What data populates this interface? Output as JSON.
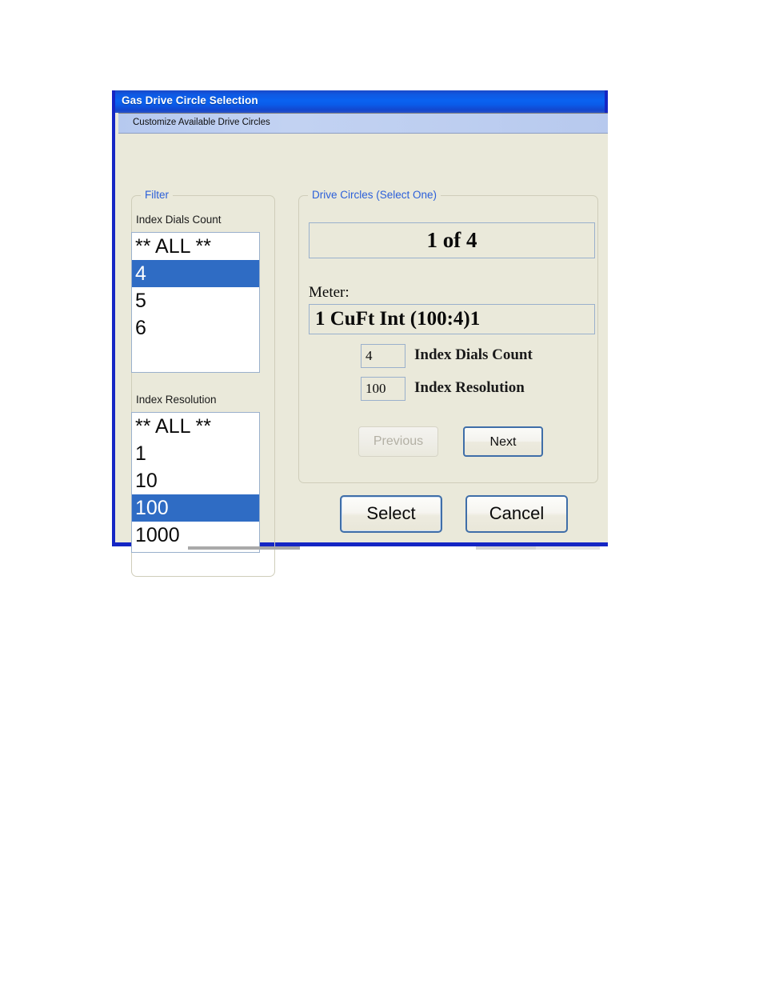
{
  "window": {
    "title": "Gas Drive Circle Selection",
    "subheader": "Customize Available Drive Circles",
    "title_bar_color": "#0a62f0",
    "frame_color": "#1526c4",
    "client_background": "#eae9da",
    "legend_color": "#2b5fd9",
    "selection_color": "#2f6cc4"
  },
  "filter": {
    "legend": "Filter",
    "dials": {
      "label": "Index Dials Count",
      "items": [
        {
          "label": "** ALL **",
          "selected": false
        },
        {
          "label": "4",
          "selected": true
        },
        {
          "label": "5",
          "selected": false
        },
        {
          "label": "6",
          "selected": false
        }
      ]
    },
    "resolution": {
      "label": "Index Resolution",
      "items": [
        {
          "label": "** ALL **",
          "selected": false
        },
        {
          "label": "1",
          "selected": false
        },
        {
          "label": "10",
          "selected": false
        },
        {
          "label": "100",
          "selected": true
        },
        {
          "label": "1000",
          "selected": false
        }
      ]
    }
  },
  "drive_circles": {
    "legend": "Drive Circles (Select One)",
    "counter": "1 of 4",
    "meter_label": "Meter:",
    "meter_value": "1 CuFt Int (100:4)1",
    "dials_value": "4",
    "dials_caption": "Index Dials Count",
    "resolution_value": "100",
    "resolution_caption": "Index Resolution",
    "previous_label": "Previous",
    "previous_enabled": false,
    "next_label": "Next",
    "next_enabled": true
  },
  "actions": {
    "select_label": "Select",
    "cancel_label": "Cancel"
  }
}
